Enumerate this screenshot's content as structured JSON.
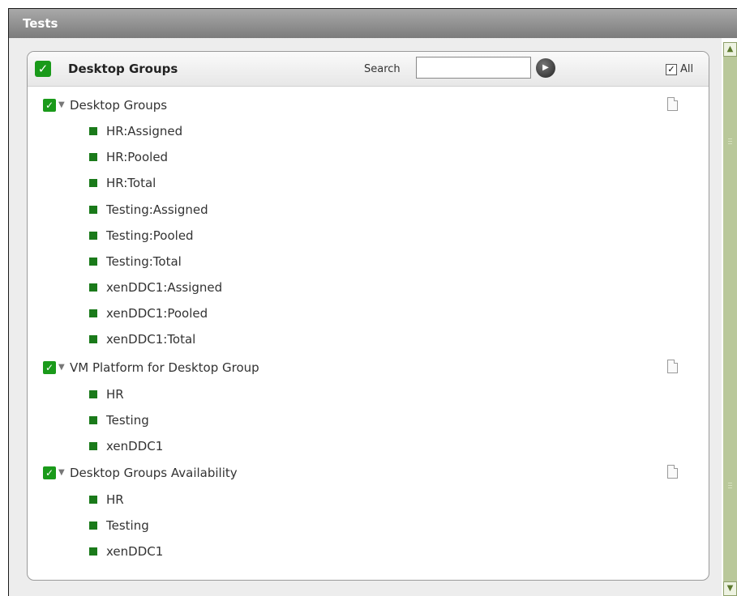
{
  "window": {
    "title": "Tests"
  },
  "panel": {
    "title": "Desktop Groups",
    "search_label": "Search",
    "search_value": "",
    "all_label": "All",
    "all_checked": true
  },
  "groups": [
    {
      "label": "Desktop Groups",
      "items": [
        "HR:Assigned",
        "HR:Pooled",
        "HR:Total",
        "Testing:Assigned",
        "Testing:Pooled",
        "Testing:Total",
        "xenDDC1:Assigned",
        "xenDDC1:Pooled",
        "xenDDC1:Total"
      ]
    },
    {
      "label": "VM Platform for Desktop Group",
      "items": [
        "HR",
        "Testing",
        "xenDDC1"
      ]
    },
    {
      "label": "Desktop Groups Availability",
      "items": [
        "HR",
        "Testing",
        "xenDDC1"
      ]
    }
  ],
  "colors": {
    "accent_green": "#1a9a1a",
    "item_green": "#1a7a1a",
    "title_bar": "#8c8c8c",
    "scrollbar": "#b9c89a"
  },
  "icons": {
    "check": "check-icon",
    "expand": "chevron-down-icon",
    "document": "document-icon",
    "go": "go-arrow-icon"
  }
}
